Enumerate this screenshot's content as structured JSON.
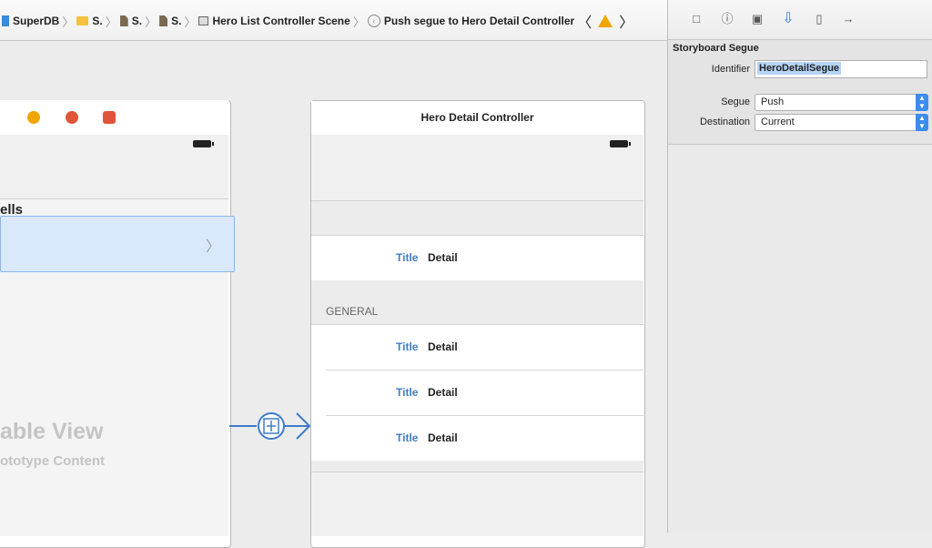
{
  "jumpbar": {
    "crumbs": [
      "SuperDB",
      "S.",
      "S.",
      "S.",
      "Hero List Controller Scene",
      "Push segue to Hero Detail Controller"
    ],
    "separator": "〉",
    "nav_back": "〈",
    "nav_forward": "〉"
  },
  "canvas": {
    "left_scene": {
      "cells_label": "ells",
      "chevron": "〉",
      "table_view_title": "Table View",
      "table_view_subtitle": "Prototype Content",
      "table_view_title_visible": "able View",
      "table_view_subtitle_visible": "ototype Content"
    },
    "hero_scene": {
      "title": "Hero Detail Controller",
      "section_general": "GENERAL",
      "rows": [
        {
          "title": "Title",
          "detail": "Detail"
        },
        {
          "title": "Title",
          "detail": "Detail"
        },
        {
          "title": "Title",
          "detail": "Detail"
        },
        {
          "title": "Title",
          "detail": "Detail"
        }
      ]
    }
  },
  "inspector": {
    "toolbar_icons": [
      "file-icon",
      "help-icon",
      "identity-icon",
      "attributes-icon",
      "size-icon",
      "connections-icon"
    ],
    "heading": "Storyboard Segue",
    "identifier_label": "Identifier",
    "identifier_value": "HeroDetailSegue",
    "segue_label": "Segue",
    "segue_value": "Push",
    "destination_label": "Destination",
    "destination_value": "Current"
  },
  "colors": {
    "accent_blue": "#3b8ded",
    "segue_blue": "#3d7cc9",
    "warning": "#f0a500"
  }
}
